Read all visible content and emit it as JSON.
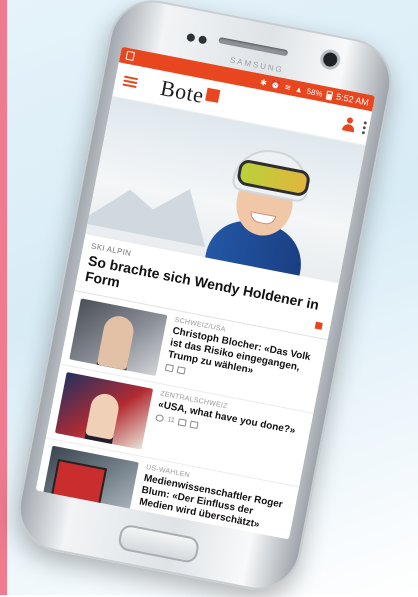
{
  "status_bar": {
    "time": "5:52 AM",
    "battery": "58%",
    "icons": [
      "bluetooth-icon",
      "mute-icon",
      "alarm-icon",
      "wifi-icon",
      "signal-icon",
      "battery-icon"
    ]
  },
  "device": {
    "brand": "SAMSUNG"
  },
  "app": {
    "logo_text": "Bote",
    "accent": "#e8461e"
  },
  "hero": {
    "kicker": "SKI ALPIN",
    "title": "So brachte sich Wendy Holdener in Form"
  },
  "articles": [
    {
      "kicker": "SCHWEIZ/USA",
      "title": "Christoph Blocher: «Das Volk ist das Risiko eingegangen, Trump zu wählen»"
    },
    {
      "kicker": "ZENTRALSCHWEIZ",
      "title": "«USA, what have you done?»",
      "comments": "11"
    },
    {
      "kicker": "US-WAHLEN",
      "title": "Medienwissenschaftler Roger Blum: «Der Einfluss der Medien wird überschätzt»"
    }
  ]
}
